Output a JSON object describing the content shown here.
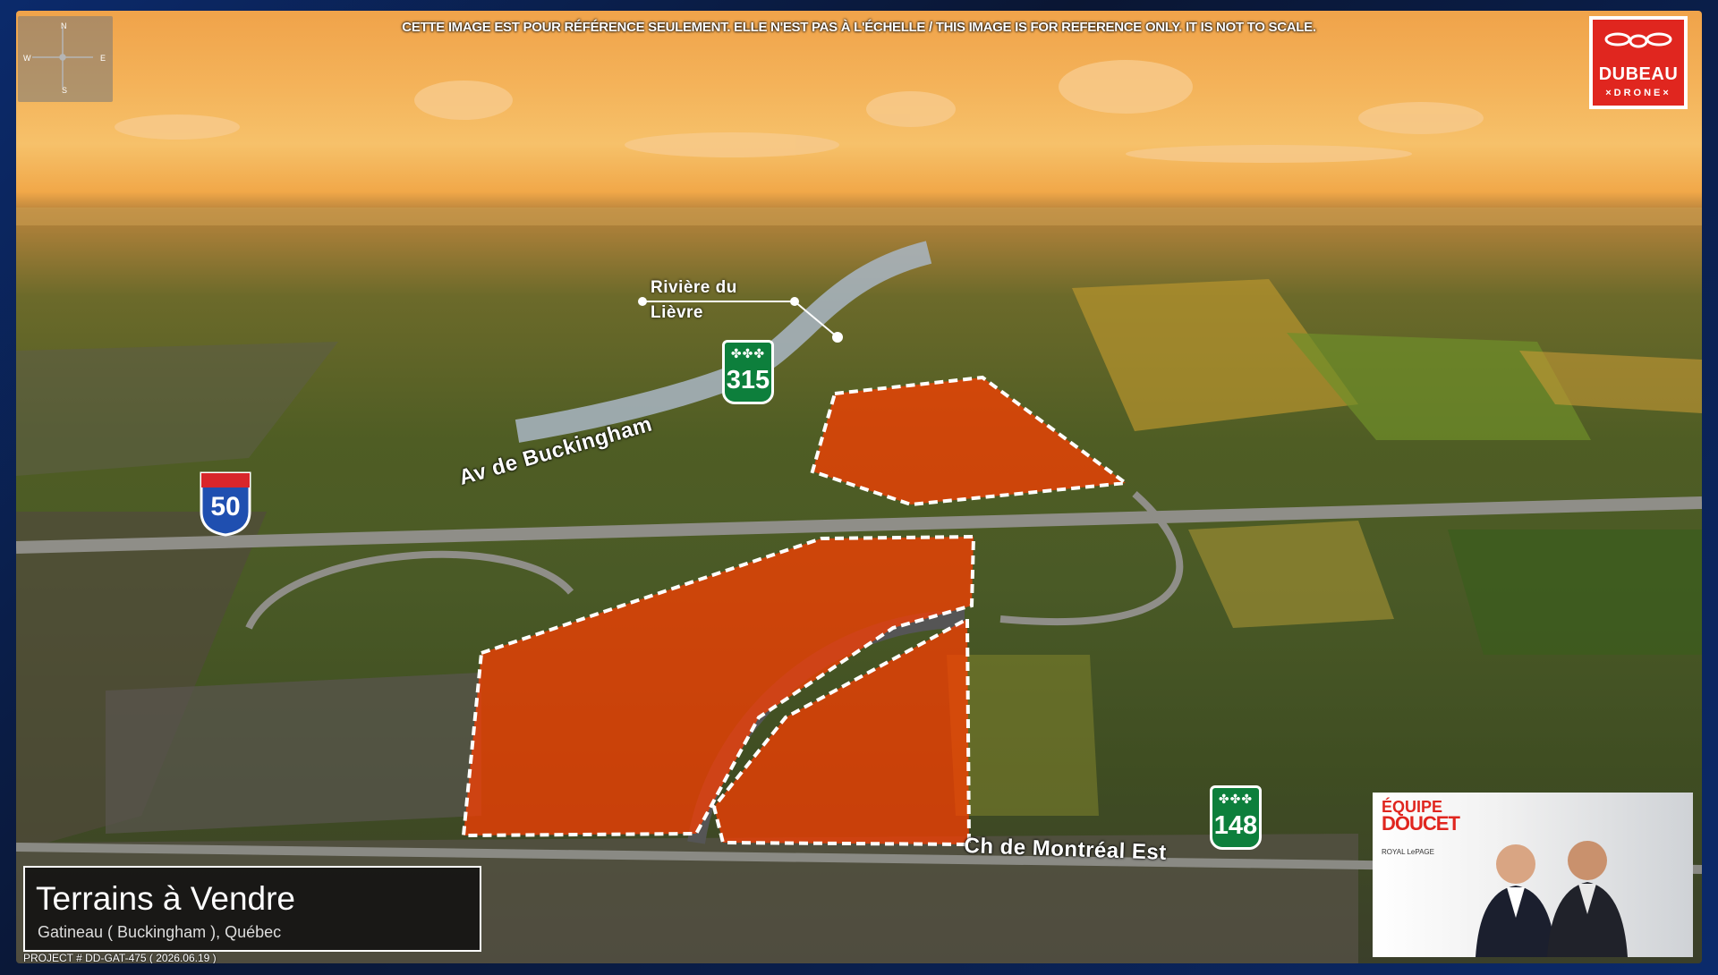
{
  "disclaimer": "CETTE IMAGE EST POUR RÉFÉRENCE SEULEMENT. ELLE N'EST PAS À L'ÉCHELLE / THIS IMAGE IS FOR REFERENCE ONLY. IT IS NOT TO SCALE.",
  "compass": {
    "n": "N",
    "s": "S",
    "e": "E",
    "w": "W"
  },
  "logo": {
    "name": "DUBEAU",
    "sub": "×DRONE×",
    "color": "#e0261f"
  },
  "labels": {
    "river": [
      "Rivière du",
      "Lièvre"
    ],
    "av_buckingham": "Av de Buckingham",
    "ch_montreal": "Ch de Montréal Est"
  },
  "shields": {
    "r315": "315",
    "r148": "148",
    "a50": "50"
  },
  "title": {
    "main": "Terrains à Vendre",
    "sub": "Gatineau ( Buckingham ), Québec"
  },
  "project": "PROJECT # DD-GAT-475 ( 2026.06.19 )",
  "agent_card": {
    "equipe": "ÉQUIPE",
    "doucet": "DOUCET",
    "brokerage": "ROYAL LePAGE"
  },
  "colors": {
    "parcel": "#ff3d00",
    "frame": "#0b2a6b"
  }
}
